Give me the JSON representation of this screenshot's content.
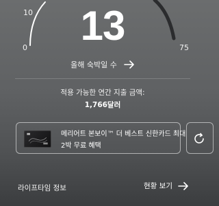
{
  "gauge": {
    "value": "13",
    "min_label": "0",
    "mid_label": "10",
    "max_label": "75"
  },
  "nights_link": {
    "label": "올해 숙박일 수",
    "icon": "arrow-right-icon"
  },
  "spend": {
    "label": "적용 가능한 연간 지출 금액:",
    "value": "1,766달러"
  },
  "promo": {
    "line1": "메리어트 본보이™ 더 베스트 신한카드 최대",
    "line2": "2박 무료 혜택",
    "card_image": "credit-card-thumbnail"
  },
  "next_card": {
    "icon": "refresh-icon"
  },
  "footer": {
    "left_label": "라이프타임 정보",
    "right_label": "현황 보기",
    "right_icon": "arrow-right-icon"
  },
  "colors": {
    "background_top": "#6b6d6e",
    "background_bottom": "#3b3d3f",
    "text": "#ffffff",
    "card_border": "#c8c8c8"
  }
}
